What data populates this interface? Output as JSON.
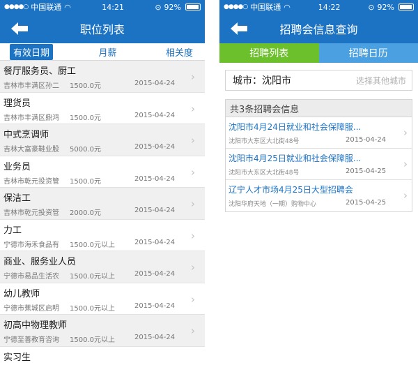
{
  "left": {
    "status": {
      "carrier": "中国联通",
      "time": "14:21",
      "battery": "92%"
    },
    "nav_title": "职位列表",
    "filters": [
      "有效日期",
      "月薪",
      "相关度"
    ],
    "jobs": [
      {
        "title": "餐厅服务员、厨工",
        "company": "吉林市丰满区孙二",
        "salary": "1500.0元",
        "date": "2015-04-24"
      },
      {
        "title": "理货员",
        "company": "吉林市丰满区鼎鸿",
        "salary": "1500.0元",
        "date": "2015-04-24"
      },
      {
        "title": "中式烹调师",
        "company": "吉林大富豪鞋业股",
        "salary": "5000.0元",
        "date": "2015-04-24"
      },
      {
        "title": "业务员",
        "company": "吉林市乾元投资管",
        "salary": "1500.0元",
        "date": "2015-04-24"
      },
      {
        "title": "保洁工",
        "company": "吉林市乾元投资管",
        "salary": "2000.0元",
        "date": "2015-04-24"
      },
      {
        "title": "力工",
        "company": "宁德市海禾食品有",
        "salary": "1500.0元以上",
        "date": "2015-04-24"
      },
      {
        "title": "商业、服务业人员",
        "company": "宁德市易品生活农",
        "salary": "1500.0元以上",
        "date": "2015-04-24"
      },
      {
        "title": "幼儿教师",
        "company": "宁德市蕉城区启明",
        "salary": "1500.0元以上",
        "date": "2015-04-24"
      },
      {
        "title": "初高中物理教师",
        "company": "宁德至善教育咨询",
        "salary": "1500.0元以上",
        "date": "2015-04-24"
      },
      {
        "title": "实习生",
        "company": "",
        "salary": "",
        "date": ""
      }
    ]
  },
  "right": {
    "status": {
      "carrier": "中国联通",
      "time": "14:22",
      "battery": "92%"
    },
    "nav_title": "招聘会信息查询",
    "tabs": [
      "招聘列表",
      "招聘日历"
    ],
    "city_label": "城市：沈阳市",
    "city_other": "选择其他城市",
    "count_text": "共3条招聘会信息",
    "fairs": [
      {
        "title": "沈阳市4月24日就业和社会保障服...",
        "address": "沈阳市大东区大北街48号",
        "date": "2015-04-24"
      },
      {
        "title": "沈阳市4月25日就业和社会保障服...",
        "address": "沈阳市大东区大北街48号",
        "date": "2015-04-25"
      },
      {
        "title": "辽宁人才市场4月25日大型招聘会",
        "address": "沈阳华府天地（一期）购物中心",
        "date": "2015-04-25"
      }
    ]
  },
  "colors": {
    "nav_blue": "#1c73c4",
    "tab_green": "#6cc02b",
    "tab_blue": "#4aa0e0"
  },
  "icons": {
    "back": "back-arrow-icon",
    "row": "chevron-right-icon"
  }
}
